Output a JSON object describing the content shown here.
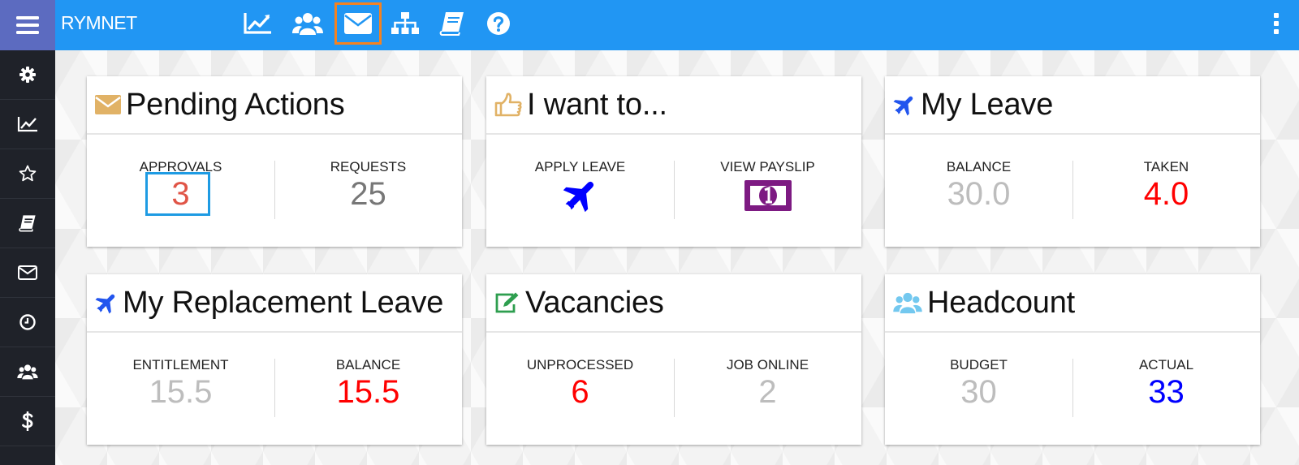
{
  "app": {
    "title": "RYMNET"
  },
  "topnav": [
    {
      "name": "dashboard",
      "icon": "line-chart-icon"
    },
    {
      "name": "team",
      "icon": "users-icon"
    },
    {
      "name": "messages",
      "icon": "envelope-icon",
      "active": true
    },
    {
      "name": "org-chart",
      "icon": "sitemap-icon"
    },
    {
      "name": "handbook",
      "icon": "book-icon"
    },
    {
      "name": "help",
      "icon": "question-circle-icon"
    }
  ],
  "sidebar": [
    {
      "name": "settings",
      "icon": "gear-icon"
    },
    {
      "name": "analytics",
      "icon": "line-chart-icon"
    },
    {
      "name": "favorites",
      "icon": "star-icon"
    },
    {
      "name": "handbook",
      "icon": "book-icon"
    },
    {
      "name": "messages",
      "icon": "envelope-icon"
    },
    {
      "name": "attendance",
      "icon": "clock-icon"
    },
    {
      "name": "team",
      "icon": "users-icon"
    },
    {
      "name": "payroll",
      "icon": "dollar-icon"
    }
  ],
  "cards": {
    "pending": {
      "title": "Pending Actions",
      "icon": "envelope-icon",
      "left": {
        "label": "APPROVALS",
        "value": "3",
        "color": "#e05547"
      },
      "right": {
        "label": "REQUESTS",
        "value": "25",
        "color": "#777777"
      }
    },
    "iwant": {
      "title": "I want to...",
      "icon": "thumbs-up-icon",
      "left": {
        "label": "APPLY LEAVE",
        "icon": "plane-icon"
      },
      "right": {
        "label": "VIEW PAYSLIP",
        "icon": "money-bill-icon"
      }
    },
    "myleave": {
      "title": "My Leave",
      "icon": "plane-icon",
      "left": {
        "label": "BALANCE",
        "value": "30.0",
        "color": "#bdbdbd"
      },
      "right": {
        "label": "TAKEN",
        "value": "4.0",
        "color": "#ff0000"
      }
    },
    "replacement": {
      "title": "My Replacement Leave",
      "icon": "plane-icon",
      "left": {
        "label": "ENTITLEMENT",
        "value": "15.5",
        "color": "#bdbdbd"
      },
      "right": {
        "label": "BALANCE",
        "value": "15.5",
        "color": "#ff0000"
      }
    },
    "vacancies": {
      "title": "Vacancies",
      "icon": "edit-icon",
      "left": {
        "label": "UNPROCESSED",
        "value": "6",
        "color": "#ff0000"
      },
      "right": {
        "label": "JOB ONLINE",
        "value": "2",
        "color": "#bdbdbd"
      }
    },
    "headcount": {
      "title": "Headcount",
      "icon": "users-icon",
      "left": {
        "label": "BUDGET",
        "value": "30",
        "color": "#bdbdbd"
      },
      "right": {
        "label": "ACTUAL",
        "value": "33",
        "color": "#0000ff"
      }
    }
  },
  "colors": {
    "topbar": "#2196f3",
    "menu": "#5c6bc0",
    "sidebar": "#1f2229",
    "highlight_active": "#f58220",
    "highlight_focus": "#1e9be3"
  }
}
